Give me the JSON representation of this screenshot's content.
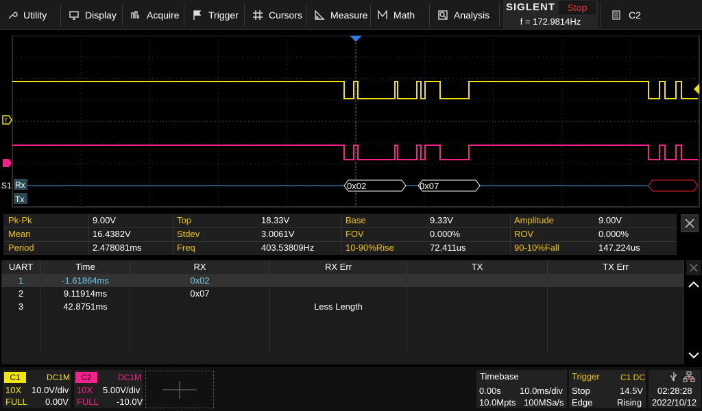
{
  "menu": {
    "items": [
      {
        "label": "Utility",
        "icon": "wrench-icon"
      },
      {
        "label": "Display",
        "icon": "monitor-icon"
      },
      {
        "label": "Acquire",
        "icon": "acquire-icon"
      },
      {
        "label": "Trigger",
        "icon": "flag-icon"
      },
      {
        "label": "Cursors",
        "icon": "cursor-crosshair-icon"
      },
      {
        "label": "Measure",
        "icon": "measure-icon"
      },
      {
        "label": "Math",
        "icon": "math-icon"
      },
      {
        "label": "Analysis",
        "icon": "analysis-icon"
      }
    ],
    "brand": "SIGLENT",
    "run_state": "Stop",
    "frequency": "f = 172.9814Hz",
    "channel_indicator": "C2"
  },
  "colors": {
    "ch1": "#f2e600",
    "ch2": "#ff1f8c",
    "bus": "#3aa0e6",
    "label_yellow": "#f0c600",
    "decode_text": "#6fc8e8",
    "stop_red": "#e23a3a"
  },
  "waveform": {
    "bus_label": "S1",
    "rx_label": "Rx",
    "tx_label": "Tx",
    "frames": [
      "0x02",
      "0x07",
      ""
    ]
  },
  "measurements": [
    {
      "label": "Pk-Pk",
      "value": "9.00V"
    },
    {
      "label": "Top",
      "value": "18.33V"
    },
    {
      "label": "Base",
      "value": "9.33V"
    },
    {
      "label": "Amplitude",
      "value": "9.00V"
    },
    {
      "label": "Mean",
      "value": "16.4382V"
    },
    {
      "label": "Stdev",
      "value": "3.0061V"
    },
    {
      "label": "FOV",
      "value": "0.000%"
    },
    {
      "label": "ROV",
      "value": "0.000%"
    },
    {
      "label": "Period",
      "value": "2.478081ms"
    },
    {
      "label": "Freq",
      "value": "403.53809Hz"
    },
    {
      "label": "10-90%Rise",
      "value": "72.411us"
    },
    {
      "label": "90-10%Fall",
      "value": "147.224us"
    }
  ],
  "decode_table": {
    "headers": [
      "UART",
      "Time",
      "RX",
      "RX Err",
      "TX",
      "TX Err"
    ],
    "rows": [
      {
        "idx": "1",
        "time": "-1.61864ms",
        "rx": "0x02",
        "rx_err": "",
        "tx": "",
        "tx_err": ""
      },
      {
        "idx": "2",
        "time": "9.11914ms",
        "rx": "0x07",
        "rx_err": "",
        "tx": "",
        "tx_err": ""
      },
      {
        "idx": "3",
        "time": "42.8751ms",
        "rx": "",
        "rx_err": "Less Length",
        "tx": "",
        "tx_err": ""
      }
    ]
  },
  "channels": {
    "c1": {
      "name": "C1",
      "coupling": "DC1M",
      "probe": "10X",
      "scale": "10.0V/div",
      "bw": "FULL",
      "offset": "0.00V"
    },
    "c2": {
      "name": "C2",
      "coupling": "DC1M",
      "probe": "10X",
      "scale": "5.00V/div",
      "bw": "FULL",
      "offset": "-10.0V"
    }
  },
  "timebase": {
    "title": "Timebase",
    "delay": "0.00s",
    "scale": "10.0ms/div",
    "points": "10.0Mpts",
    "rate": "100MSa/s"
  },
  "trigger": {
    "title": "Trigger",
    "source": "C1 DC",
    "state": "Stop",
    "level": "14.5V",
    "type": "Edge",
    "slope": "Rising"
  },
  "clock": {
    "time": "02:28:28",
    "date": "2022/10/12"
  }
}
